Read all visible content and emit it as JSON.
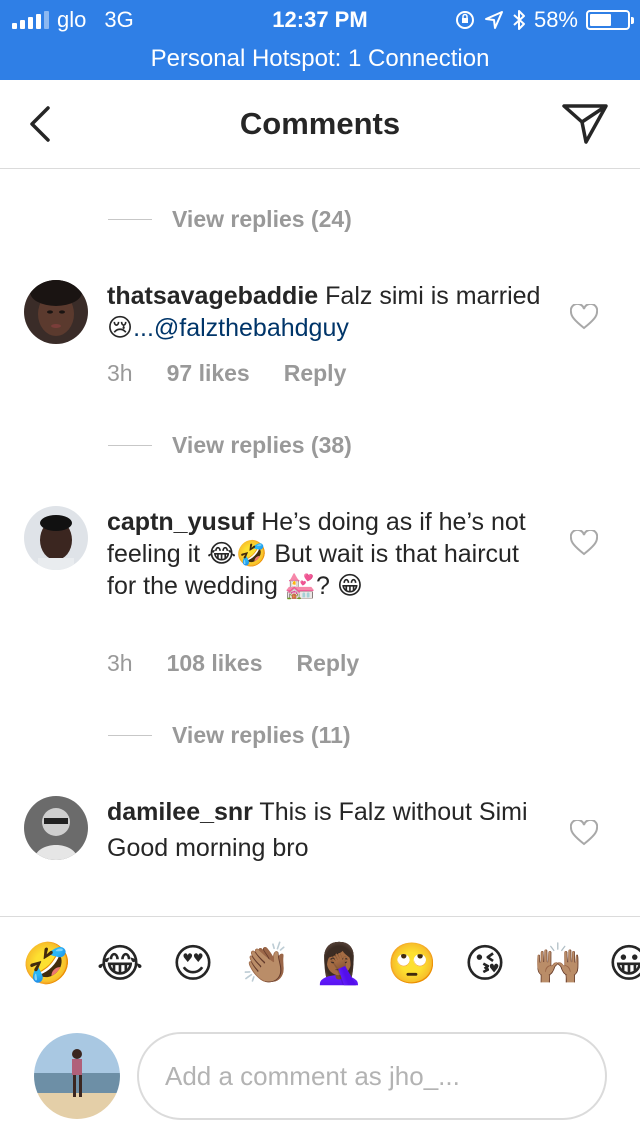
{
  "status_bar": {
    "carrier": "glo",
    "network": "3G",
    "time": "12:37 PM",
    "battery": "58%",
    "battery_level": 0.58
  },
  "hotspot_banner": "Personal Hotspot: 1 Connection",
  "nav": {
    "title": "Comments",
    "back_icon": "chevron-left-icon",
    "send_icon": "paper-plane-icon"
  },
  "reply_threads": [
    {
      "label": "View replies (24)"
    },
    {
      "label": "View replies (38)"
    },
    {
      "label": "View replies (11)"
    }
  ],
  "comments": [
    {
      "username": "thatsavagebaddie",
      "text": "Falz simi is married",
      "emoji": "😢",
      "mention": "...@falzthebahdguy",
      "time": "3h",
      "likes": "97 likes",
      "reply": "Reply"
    },
    {
      "username": "captn_yusuf",
      "text": "He’s doing as if he’s not feeling it 😂🤣 But wait is that haircut for the wedding 💒? 😁",
      "time": "3h",
      "likes": "108 likes",
      "reply": "Reply"
    },
    {
      "username": "damilee_snr",
      "text": "This is Falz without Simi",
      "text2": "Good morning bro"
    }
  ],
  "emoji_bar": [
    "🤣",
    "😂",
    "😍",
    "👏🏽",
    "🤦🏾‍♀️",
    "🙄",
    "😘",
    "🙌🏽",
    "😀"
  ],
  "composer": {
    "placeholder": "Add a comment as jho_..."
  },
  "colors": {
    "status_blue": "#2f7fe6",
    "mention_blue": "#003569",
    "muted_gray": "#999999"
  }
}
